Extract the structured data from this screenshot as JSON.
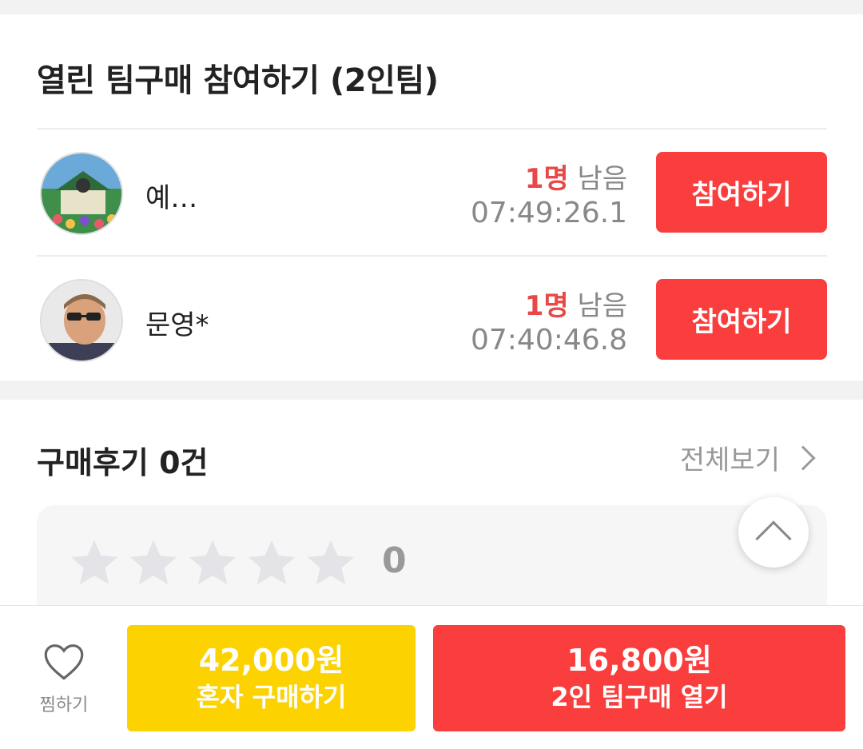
{
  "team_buy": {
    "title": "열린 팀구매 참여하기 (2인팀)",
    "teams": [
      {
        "name": "예…",
        "remaining_count": "1명",
        "remaining_suffix": "남음",
        "timer": "07:49:26.1",
        "join_label": "참여하기",
        "avatar": "avatar-illustration"
      },
      {
        "name": "문영*",
        "remaining_count": "1명",
        "remaining_suffix": "남음",
        "timer": "07:40:46.8",
        "join_label": "참여하기",
        "avatar": "avatar-photo"
      }
    ]
  },
  "reviews": {
    "title": "구매후기 0건",
    "see_all": "전체보기",
    "stars_filled": 0,
    "stars_total": 5,
    "rating": "0"
  },
  "bottom_bar": {
    "wish_label": "찜하기",
    "solo": {
      "price": "42,000원",
      "label": "혼자 구매하기"
    },
    "team": {
      "price": "16,800원",
      "label": "2인 팀구매 열기"
    }
  },
  "colors": {
    "accent_red": "#fa3e3e",
    "accent_yellow": "#fcd200",
    "remaining_red": "#e84848",
    "muted": "#888888"
  },
  "icons": [
    "heart-icon",
    "chevron-right-icon",
    "chevron-up-icon",
    "star-icon"
  ]
}
